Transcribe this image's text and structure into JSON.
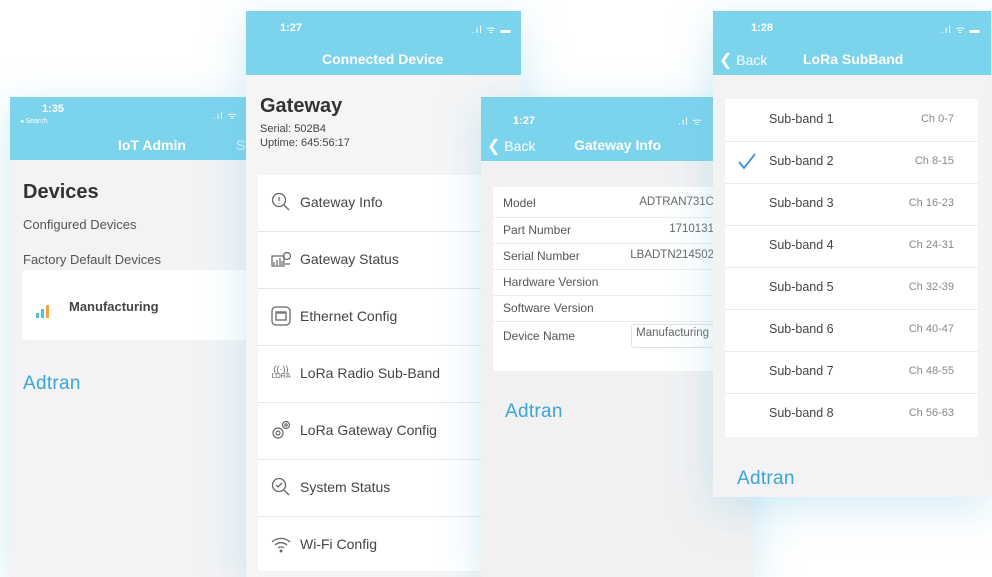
{
  "colors": {
    "accent": "#7cd3ec",
    "brand": "#3aa6d6",
    "check": "#2f8de4"
  },
  "screen1": {
    "status": {
      "time": "1:35",
      "back_hint": "◂ Search"
    },
    "nav": {
      "title": "IoT Admin",
      "right_cut": "S"
    },
    "heading": "Devices",
    "links": {
      "configured": "Configured Devices",
      "factory": "Factory Default Devices"
    },
    "device": {
      "name": "Manufacturing",
      "icon": "signal-bars-icon"
    },
    "brand": "Adtran"
  },
  "screen2": {
    "status": {
      "time": "1:27"
    },
    "nav": {
      "title": "Connected Device"
    },
    "title": "Gateway",
    "serial": "Serial: 502B4",
    "uptime": "Uptime: 645:56:17",
    "menu": [
      {
        "label": "Gateway Info",
        "icon": "gateway-info-icon"
      },
      {
        "label": "Gateway Status",
        "icon": "gateway-status-icon"
      },
      {
        "label": "Ethernet Config",
        "icon": "ethernet-icon"
      },
      {
        "label": "LoRa Radio Sub-Band",
        "icon": "lora-radio-icon"
      },
      {
        "label": "LoRa Gateway Config",
        "icon": "gear-icon"
      },
      {
        "label": "System Status",
        "icon": "system-status-icon"
      },
      {
        "label": "Wi-Fi Config",
        "icon": "wifi-icon"
      }
    ]
  },
  "screen3": {
    "status": {
      "time": "1:27"
    },
    "nav": {
      "back": "Back",
      "title": "Gateway Info"
    },
    "rows": [
      {
        "key": "Model",
        "value": "ADTRAN731C"
      },
      {
        "key": "Part Number",
        "value": "1710131"
      },
      {
        "key": "Serial Number",
        "value": "LBADTN214502"
      },
      {
        "key": "Hardware Version",
        "value": ""
      },
      {
        "key": "Software Version",
        "value": ""
      },
      {
        "key": "Device Name",
        "value": "Manufacturing"
      }
    ],
    "brand": "Adtran"
  },
  "screen4": {
    "status": {
      "time": "1:28"
    },
    "nav": {
      "back": "Back",
      "title": "LoRa SubBand"
    },
    "selected": 1,
    "bands": [
      {
        "name": "Sub-band 1",
        "channels": "Ch 0-7"
      },
      {
        "name": "Sub-band 2",
        "channels": "Ch 8-15"
      },
      {
        "name": "Sub-band 3",
        "channels": "Ch 16-23"
      },
      {
        "name": "Sub-band 4",
        "channels": "Ch 24-31"
      },
      {
        "name": "Sub-band 5",
        "channels": "Ch 32-39"
      },
      {
        "name": "Sub-band 6",
        "channels": "Ch 40-47"
      },
      {
        "name": "Sub-band 7",
        "channels": "Ch 48-55"
      },
      {
        "name": "Sub-band 8",
        "channels": "Ch 56-63"
      }
    ],
    "brand": "Adtran"
  }
}
